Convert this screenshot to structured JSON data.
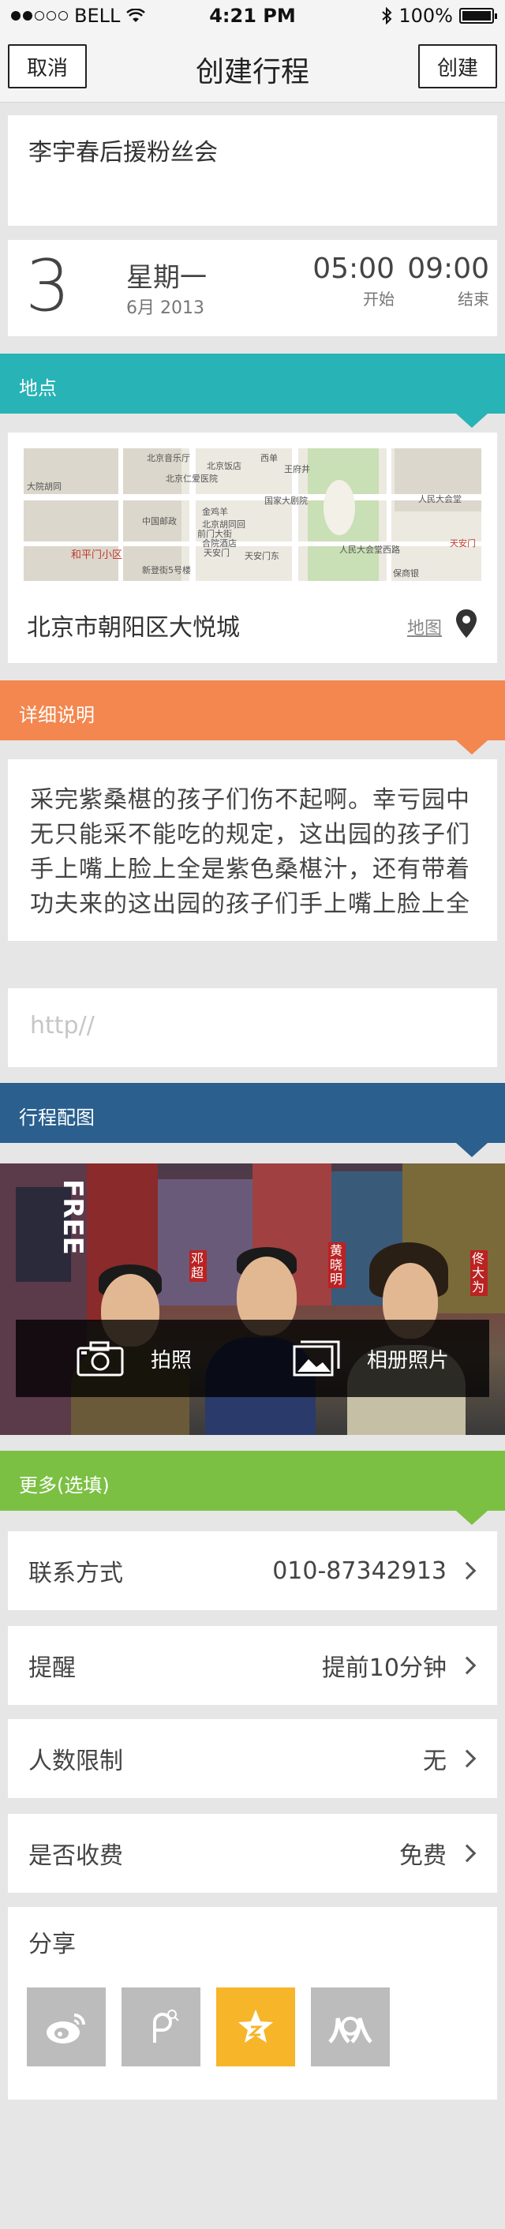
{
  "status_bar": {
    "carrier": "BELL",
    "time": "4:21 PM",
    "battery": "100%"
  },
  "nav": {
    "cancel_label": "取消",
    "title": "创建行程",
    "create_label": "创建"
  },
  "event": {
    "name": "李宇春后援粉丝会"
  },
  "date": {
    "day": "3",
    "weekday": "星期一",
    "month_year": "6月 2013",
    "start_time": "05:00",
    "start_label": "开始",
    "end_time": "09:00",
    "end_label": "结束"
  },
  "sections": {
    "place": "地点",
    "details": "详细说明",
    "photo": "行程配图",
    "more": "更多(选填)"
  },
  "place": {
    "name": "北京市朝阳区大悦城",
    "map_link": "地图",
    "map_labels": [
      "北京音乐厅",
      "北京饭店",
      "西单",
      "北京仁爱医院",
      "王府井",
      "大院胡同",
      "中国邮政",
      "金鸡羊",
      "国家大剧院",
      "人民大会堂",
      "和平门小区",
      "新登街5号楼",
      "天安门东",
      "前门大街",
      "北京胡同回",
      "合院酒店",
      "天安门",
      "人民大会堂西路",
      "保商银",
      "天安门"
    ]
  },
  "details": {
    "text": "采完紫桑椹的孩子们伤不起啊。幸亏园中无只能采不能吃的规定，这出园的孩子们手上嘴上脸上全是紫色桑椹汁，还有带着功夫来的这出园的孩子们手上嘴上脸上全是紫色桑椹汁，还"
  },
  "url": {
    "placeholder": "http//"
  },
  "photo": {
    "camera_label": "拍照",
    "album_label": "相册照片",
    "signs": [
      "FREE",
      "邓超",
      "黄晓明",
      "佟大为"
    ]
  },
  "more": {
    "contact_label": "联系方式",
    "contact_value": "010-87342913",
    "remind_label": "提醒",
    "remind_value": "提前10分钟",
    "limit_label": "人数限制",
    "limit_value": "无",
    "fee_label": "是否收费",
    "fee_value": "免费"
  },
  "share": {
    "title": "分享",
    "icons": [
      "weibo-icon",
      "pinyin-icon",
      "star-icon",
      "renren-icon"
    ],
    "active_color": "#f7b52a"
  },
  "colors": {
    "place": "#28b3b6",
    "details": "#f3874f",
    "photo": "#2a5f8e",
    "more": "#7bc043"
  }
}
